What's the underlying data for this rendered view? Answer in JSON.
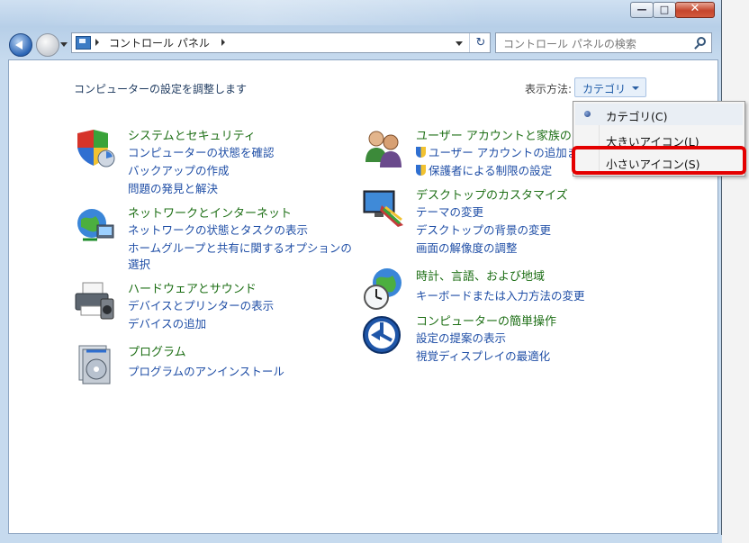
{
  "window": {
    "minimize_glyph": "—",
    "maximize_glyph": "□",
    "close_glyph": "✕"
  },
  "addressbar": {
    "breadcrumb": "コントロール パネル",
    "refresh_glyph": "↻"
  },
  "search": {
    "placeholder": "コントロール パネルの検索"
  },
  "page": {
    "heading": "コンピューターの設定を調整します",
    "view_by_label": "表示方法:",
    "view_by_value": "カテゴリ"
  },
  "categories": [
    {
      "title": "システムとセキュリティ",
      "icon": "shield-icon",
      "links": [
        "コンピューターの状態を確認",
        "バックアップの作成",
        "問題の発見と解決"
      ]
    },
    {
      "title": "ネットワークとインターネット",
      "icon": "network-globe-icon",
      "links": [
        "ネットワークの状態とタスクの表示",
        "ホームグループと共有に関するオプションの",
        "選択"
      ]
    },
    {
      "title": "ハードウェアとサウンド",
      "icon": "printer-icon",
      "links": [
        "デバイスとプリンターの表示",
        "デバイスの追加"
      ]
    },
    {
      "title": "プログラム",
      "icon": "programs-icon",
      "links": [
        "プログラムのアンインストール"
      ]
    },
    {
      "title": "ユーザー アカウントと家族のた",
      "icon": "users-icon",
      "links": [
        "ユーザー アカウントの追加ま",
        "保護者による制限の設定"
      ]
    },
    {
      "title": "デスクトップのカスタマイズ",
      "icon": "desktop-paint-icon",
      "links": [
        "テーマの変更",
        "デスクトップの背景の変更",
        "画面の解像度の調整"
      ]
    },
    {
      "title": "時計、言語、および地域",
      "icon": "clock-globe-icon",
      "links": [
        "キーボードまたは入力方法の変更"
      ]
    },
    {
      "title": "コンピューターの簡単操作",
      "icon": "ease-of-access-icon",
      "links": [
        "設定の提案の表示",
        "視覚ディスプレイの最適化"
      ]
    }
  ],
  "view_menu": {
    "items": [
      "カテゴリ(C)",
      "大きいアイコン(L)",
      "小さいアイコン(S)"
    ],
    "selected": "カテゴリ(C)",
    "highlight_color": "#e40000"
  }
}
